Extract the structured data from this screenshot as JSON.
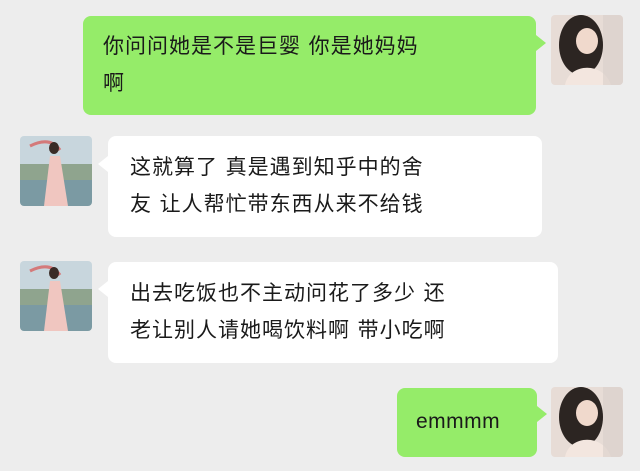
{
  "colors": {
    "background": "#ededed",
    "sent_bubble": "#95ec69",
    "received_bubble": "#ffffff",
    "text": "#1a1a1a"
  },
  "messages": [
    {
      "sender": "self",
      "lines": [
        "你问问她是不是巨婴  你是她妈妈",
        "啊"
      ]
    },
    {
      "sender": "other",
      "lines": [
        "这就算了  真是遇到知乎中的舍",
        "友  让人帮忙带东西从来不给钱"
      ]
    },
    {
      "sender": "other",
      "lines": [
        "出去吃饭也不主动问花了多少  还",
        "老让别人请她喝饮料啊  带小吃啊"
      ]
    },
    {
      "sender": "self",
      "lines": [
        "emmmm"
      ]
    }
  ]
}
